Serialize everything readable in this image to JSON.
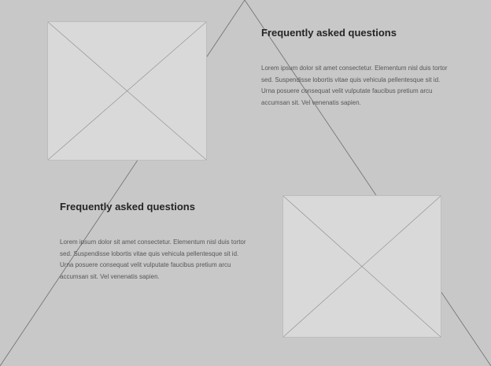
{
  "sections": [
    {
      "title": "Frequently asked questions",
      "body": "Lorem ipsum dolor sit amet consectetur. Elementum nisl duis tortor sed. Suspendisse lobortis vitae quis vehicula pellentesque sit id. Urna posuere consequat velit vulputate faucibus pretium arcu accumsan sit. Vel venenatis sapien."
    },
    {
      "title": "Frequently asked questions",
      "body": "Lorem ipsum dolor sit amet consectetur. Elementum nisl duis tortor sed. Suspendisse lobortis vitae quis vehicula pellentesque sit id. Urna posuere consequat velit vulputate faucibus pretium arcu accumsan sit. Vel venenatis sapien."
    }
  ],
  "colors": {
    "background": "#c8c8c8",
    "placeholder": "#d9d9d9",
    "title": "#252525",
    "body_text": "#575757",
    "line": "#6e6e6e"
  }
}
